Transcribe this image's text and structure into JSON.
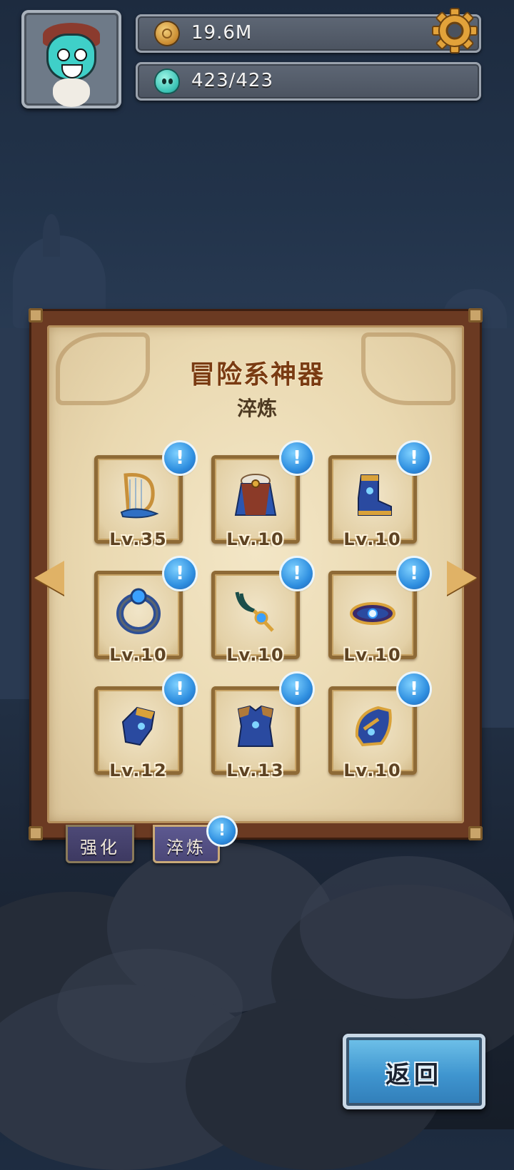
{
  "hud": {
    "coins": "19.6M",
    "stamina": "423/423"
  },
  "panel": {
    "title": "冒险系神器",
    "subtitle": "淬炼"
  },
  "artifacts": [
    {
      "level": "Lv.35",
      "icon": "harp-icon",
      "badge": "!"
    },
    {
      "level": "Lv.10",
      "icon": "cloak-icon",
      "badge": "!"
    },
    {
      "level": "Lv.10",
      "icon": "boots-icon",
      "badge": "!"
    },
    {
      "level": "Lv.10",
      "icon": "ring-icon",
      "badge": "!"
    },
    {
      "level": "Lv.10",
      "icon": "necklace-icon",
      "badge": "!"
    },
    {
      "level": "Lv.10",
      "icon": "crown-icon",
      "badge": "!"
    },
    {
      "level": "Lv.12",
      "icon": "gauntlet-icon",
      "badge": "!"
    },
    {
      "level": "Lv.13",
      "icon": "armor-icon",
      "badge": "!"
    },
    {
      "level": "Lv.10",
      "icon": "helmet-icon",
      "badge": "!"
    }
  ],
  "tabs": [
    {
      "label": "强化"
    },
    {
      "label": "淬炼",
      "badge": "!"
    }
  ],
  "back_button": {
    "label": "返回"
  },
  "colors": {
    "title": "#7a3b12",
    "badge": "#2f8fe0",
    "back_button": "#3f95cf",
    "panel_frame": "#6b3a22",
    "parchment": "#ead9b1"
  }
}
